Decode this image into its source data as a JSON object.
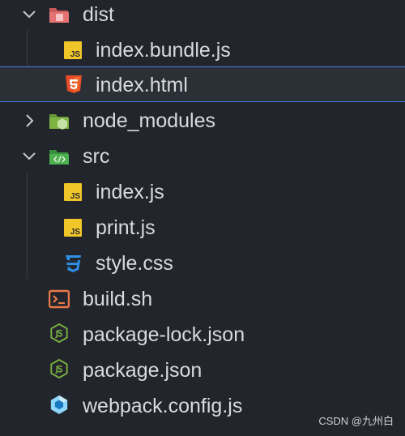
{
  "tree": [
    {
      "label": "dist",
      "icon": "folder-dist-open-icon",
      "kind": "folder",
      "expanded": true
    },
    {
      "label": "index.bundle.js",
      "icon": "javascript-file-icon",
      "kind": "file"
    },
    {
      "label": "index.html",
      "icon": "html5-file-icon",
      "kind": "file",
      "selected": true
    },
    {
      "label": "node_modules",
      "icon": "folder-node-icon",
      "kind": "folder",
      "expanded": false
    },
    {
      "label": "src",
      "icon": "folder-src-open-icon",
      "kind": "folder",
      "expanded": true
    },
    {
      "label": "index.js",
      "icon": "javascript-file-icon",
      "kind": "file"
    },
    {
      "label": "print.js",
      "icon": "javascript-file-icon",
      "kind": "file"
    },
    {
      "label": "style.css",
      "icon": "css3-file-icon",
      "kind": "file"
    },
    {
      "label": "build.sh",
      "icon": "shell-script-icon",
      "kind": "file"
    },
    {
      "label": "package-lock.json",
      "icon": "nodejs-file-icon",
      "kind": "file"
    },
    {
      "label": "package.json",
      "icon": "nodejs-file-icon",
      "kind": "file"
    },
    {
      "label": "webpack.config.js",
      "icon": "webpack-file-icon",
      "kind": "file"
    }
  ],
  "js_badge_text": "JS",
  "watermark": "CSDN @九州白",
  "colors": {
    "background": "#22252b",
    "selection_border": "#4b7fe4",
    "text": "#d7dae0",
    "js_yellow": "#f0c629",
    "html_orange": "#e44d26",
    "css_blue": "#2f8ee5",
    "node_green": "#7cb342",
    "src_green": "#4caf50",
    "dist_pink": "#e57373",
    "shell_orange": "#e8794a",
    "webpack_blue": "#5fa8d3"
  }
}
